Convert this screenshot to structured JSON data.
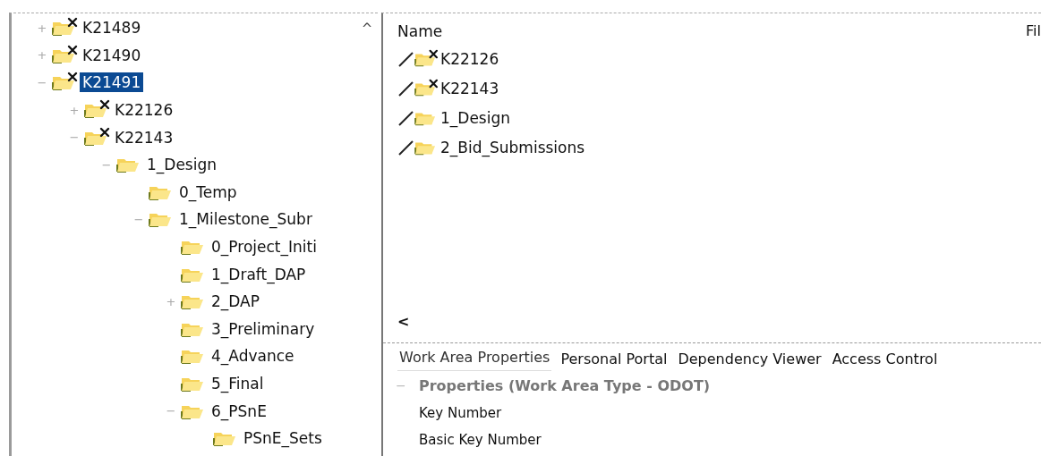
{
  "tree": {
    "scroll_up": "^",
    "items": [
      {
        "label": "K21489",
        "kind": "workarea",
        "toggle": "+",
        "selected": false
      },
      {
        "label": "K21490",
        "kind": "workarea",
        "toggle": "+",
        "selected": false
      },
      {
        "label": "K21491",
        "kind": "workarea",
        "toggle": "−",
        "selected": true,
        "children": [
          {
            "label": "K22126",
            "kind": "workarea",
            "toggle": "+",
            "selected": false
          },
          {
            "label": "K22143",
            "kind": "workarea",
            "toggle": "−",
            "selected": false,
            "children": [
              {
                "label": "1_Design",
                "kind": "folder",
                "toggle": "−",
                "selected": false,
                "children": [
                  {
                    "label": "0_Temp",
                    "kind": "folder",
                    "selected": false
                  },
                  {
                    "label": "1_Milestone_Subr",
                    "kind": "folder",
                    "toggle": "−",
                    "selected": false,
                    "children": [
                      {
                        "label": "0_Project_Initi",
                        "kind": "folder",
                        "selected": false
                      },
                      {
                        "label": "1_Draft_DAP",
                        "kind": "folder",
                        "selected": false
                      },
                      {
                        "label": "2_DAP",
                        "kind": "folder",
                        "toggle": "+",
                        "selected": false
                      },
                      {
                        "label": "3_Preliminary",
                        "kind": "folder",
                        "selected": false
                      },
                      {
                        "label": "4_Advance",
                        "kind": "folder",
                        "selected": false
                      },
                      {
                        "label": "5_Final",
                        "kind": "folder",
                        "selected": false
                      },
                      {
                        "label": "6_PSnE",
                        "kind": "folder",
                        "toggle": "−",
                        "selected": false,
                        "children": [
                          {
                            "label": "PSnE_Sets",
                            "kind": "folder",
                            "selected": false
                          }
                        ]
                      }
                    ]
                  }
                ]
              }
            ]
          }
        ]
      }
    ]
  },
  "list": {
    "columns": [
      "Name",
      "Fil"
    ],
    "scroll_left": "<",
    "rows": [
      {
        "name": "K22126",
        "kind": "workarea"
      },
      {
        "name": "K22143",
        "kind": "workarea"
      },
      {
        "name": "1_Design",
        "kind": "folder"
      },
      {
        "name": "2_Bid_Submissions",
        "kind": "folder"
      }
    ]
  },
  "tabs": [
    {
      "label": "Work Area Properties",
      "selected": true
    },
    {
      "label": "Personal Portal",
      "selected": false
    },
    {
      "label": "Dependency Viewer",
      "selected": false
    },
    {
      "label": "Access Control",
      "selected": false
    }
  ],
  "properties": {
    "toggle": "−",
    "group": "Properties (Work Area Type - ODOT)",
    "rows": [
      "Key Number",
      "Basic Key Number"
    ]
  }
}
